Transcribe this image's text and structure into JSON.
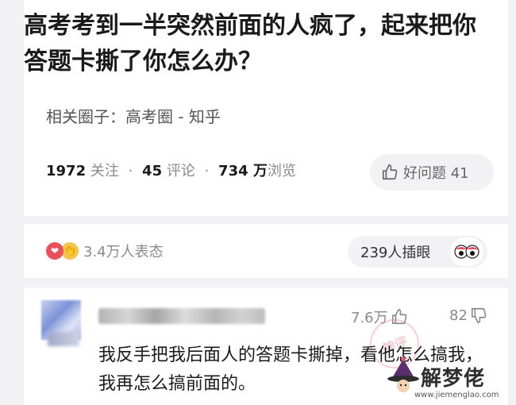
{
  "question": {
    "title": "高考考到一半突然前面的人疯了，起来把你答题卡撕了你怎么办？",
    "circle": "相关圈子：高考圈 - 知乎",
    "follow_count": "1972",
    "follow_label": "关注",
    "comment_count": "45",
    "comment_label": "评论",
    "view_count": "734 万",
    "view_label": "浏览",
    "good_question_label": "好问题 41"
  },
  "reactions": {
    "summary": "3.4万人表态",
    "eye_roll_label": "239人插眼"
  },
  "answer": {
    "like_count": "7.6万",
    "dislike_count": "82",
    "text": "我反手把我后面人的答题卡撕掉，看他怎么搞我，我再怎么搞前面的。"
  },
  "watermark": {
    "stamp_text": "神评",
    "brand": "解梦佬",
    "url": "www.jiemenglao.com"
  },
  "colors": {
    "heart_red": "#e8505b",
    "background_gray": "#f2f2f4"
  }
}
